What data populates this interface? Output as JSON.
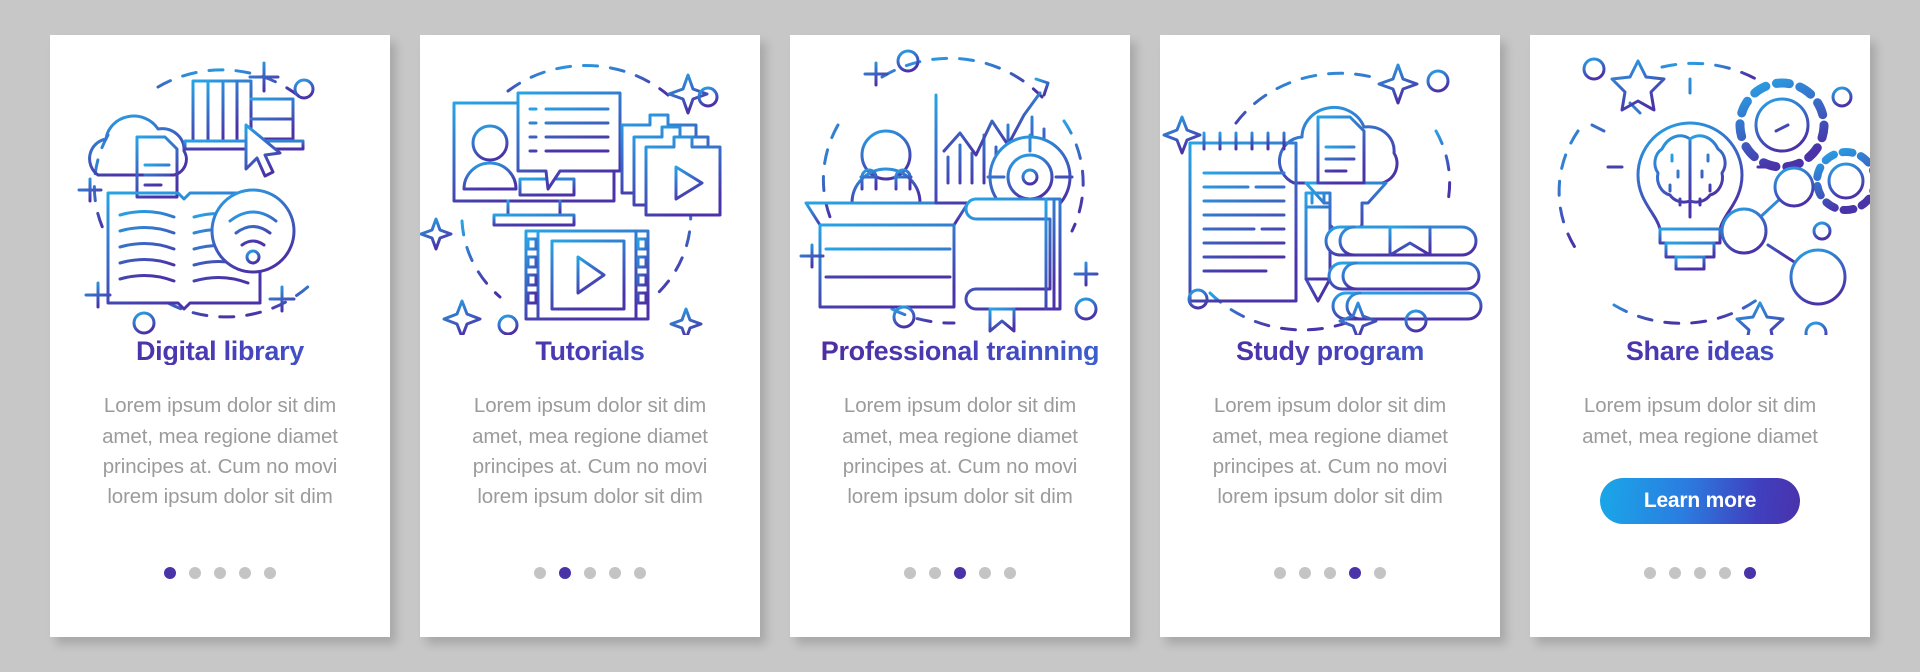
{
  "canvas": {
    "background_color": "#c7c7c7",
    "card_background_color": "#ffffff",
    "title_gradient": [
      "#4f2d9e",
      "#3c5fd0"
    ],
    "body_text_color": "#9b9b9b",
    "dot_active_color": "#4a33a8",
    "dot_inactive_color": "#c4c4c4",
    "illustration_stroke_gradient": [
      "#27a4e6",
      "#4a33a8"
    ]
  },
  "body_text": "Lorem ipsum dolor sit dim amet, mea regione diamet principes at. Cum no movi lorem ipsum dolor sit dim",
  "body_text_short": "Lorem ipsum dolor sit dim amet, mea regione diamet",
  "cards": [
    {
      "title": "Digital library",
      "body": "Lorem ipsum dolor sit dim amet, mea regione diamet principes at. Cum no movi lorem ipsum dolor sit dim",
      "icons": [
        "cloud-icon",
        "document-icon",
        "bookshelf-icon",
        "cursor-icon",
        "open-book-icon",
        "wifi-icon",
        "plus-icon",
        "circle-icon",
        "dashed-circle-icon"
      ],
      "dots": {
        "count": 5,
        "active": 1
      },
      "button": null
    },
    {
      "title": "Tutorials",
      "body": "Lorem ipsum dolor sit dim amet, mea regione diamet principes at. Cum no movi lorem ipsum dolor sit dim",
      "icons": [
        "monitor-icon",
        "user-avatar-icon",
        "speech-bubble-icon",
        "folder-stack-icon",
        "play-icon",
        "film-strip-icon",
        "sparkle-icon",
        "circle-icon",
        "dashed-circle-icon"
      ],
      "dots": {
        "count": 5,
        "active": 2
      },
      "button": null
    },
    {
      "title": "Professional trainning",
      "body": "Lorem ipsum dolor sit dim amet, mea regione diamet principes at. Cum no movi lorem ipsum dolor sit dim",
      "icons": [
        "speaker-podium-icon",
        "microphone-icon",
        "bar-chart-icon",
        "growth-arrow-icon",
        "target-icon",
        "closed-book-icon",
        "bookmark-icon",
        "plus-icon",
        "circle-icon",
        "dashed-circle-icon"
      ],
      "dots": {
        "count": 5,
        "active": 3
      },
      "button": null
    },
    {
      "title": "Study program",
      "body": "Lorem ipsum dolor sit dim amet, mea regione diamet principes at. Cum no movi lorem ipsum dolor sit dim",
      "icons": [
        "spiral-notepad-icon",
        "pencil-icon",
        "cloud-download-icon",
        "document-icon",
        "book-stack-icon",
        "bookmark-icon",
        "sparkle-icon",
        "circle-icon",
        "dashed-circle-icon"
      ],
      "dots": {
        "count": 5,
        "active": 4
      },
      "button": null
    },
    {
      "title": "Share ideas",
      "body": "Lorem ipsum dolor sit dim amet, mea regione diamet",
      "icons": [
        "lightbulb-brain-icon",
        "gear-icon",
        "network-nodes-icon",
        "star-icon",
        "circle-icon",
        "dashed-circle-icon"
      ],
      "dots": {
        "count": 5,
        "active": 5
      },
      "button": {
        "label": "Learn more",
        "gradient": [
          "#19a7e8",
          "#4a32ab"
        ]
      }
    }
  ]
}
